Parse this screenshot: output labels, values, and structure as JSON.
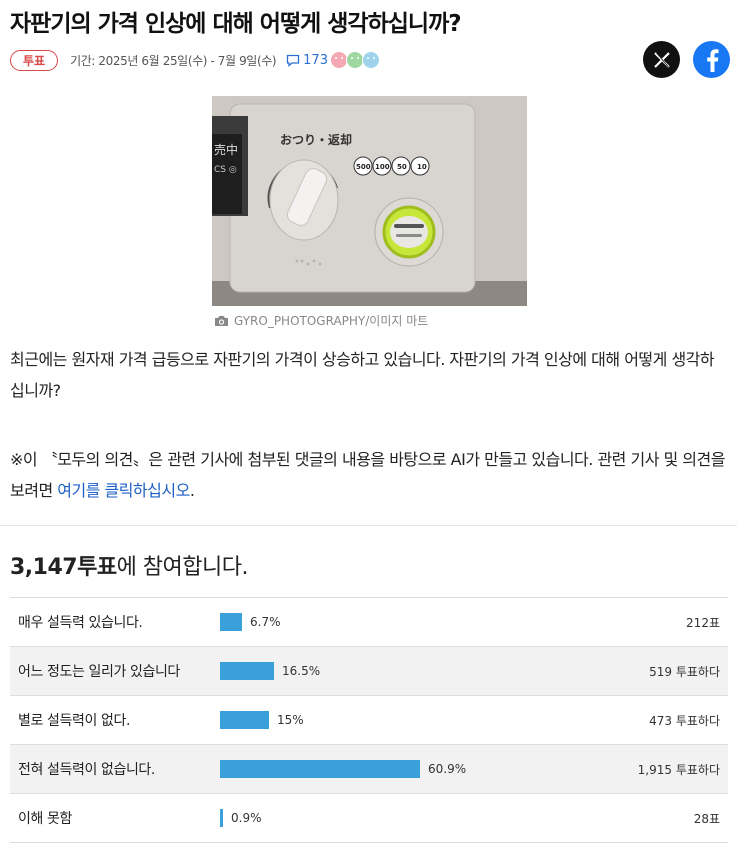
{
  "title": "자판기의 가격 인상에 대해 어떻게 생각하십니까?",
  "meta": {
    "badge": "투표",
    "period": "기간: 2025년 6월 25일(수) - 7월 9일(수)",
    "comment_count": "173"
  },
  "share": {
    "x_label": "X",
    "facebook_label": "f"
  },
  "photo": {
    "credit": "GYRO_PHOTOGRAPHY/이미지 마트",
    "sign_top": "おつり・返却",
    "coins": [
      "500",
      "100",
      "50",
      "10"
    ]
  },
  "body": {
    "paragraph1": "최근에는 원자재 가격 급등으로 자판기의 가격이 상승하고 있습니다. 자판기의 가격 인상에 대해 어떻게 생각하십니까?",
    "note_prefix": "※이 〝모두의 의견〟은 관련 기사에 첨부된 댓글의 내용을 바탕으로 AI가 만들고 있습니다. 관련 기사 및 의견을 보려면 ",
    "note_link": "여기를 클릭하십시오",
    "note_suffix": "."
  },
  "votes": {
    "total": "3,147",
    "suffix_bold": "투표",
    "suffix": "에 참여합니다."
  },
  "options": [
    {
      "label": "매우 설득력 있습니다.",
      "percent": 6.7,
      "percent_label": "6.7%",
      "count_label": "212표"
    },
    {
      "label": "어느 정도는 일리가 있습니다",
      "percent": 16.5,
      "percent_label": "16.5%",
      "count_label": "519 투표하다"
    },
    {
      "label": "별로 설득력이 없다.",
      "percent": 15,
      "percent_label": "15%",
      "count_label": "473 투표하다"
    },
    {
      "label": "전혀 설득력이 없습니다.",
      "percent": 60.9,
      "percent_label": "60.9%",
      "count_label": "1,915 투표하다"
    },
    {
      "label": "이해 못함",
      "percent": 0.9,
      "percent_label": "0.9%",
      "count_label": "28표"
    }
  ],
  "colors": {
    "bar": "#3aa0dc",
    "badge": "#d84848",
    "link": "#1d5fc4",
    "facebook": "#1877f2"
  }
}
